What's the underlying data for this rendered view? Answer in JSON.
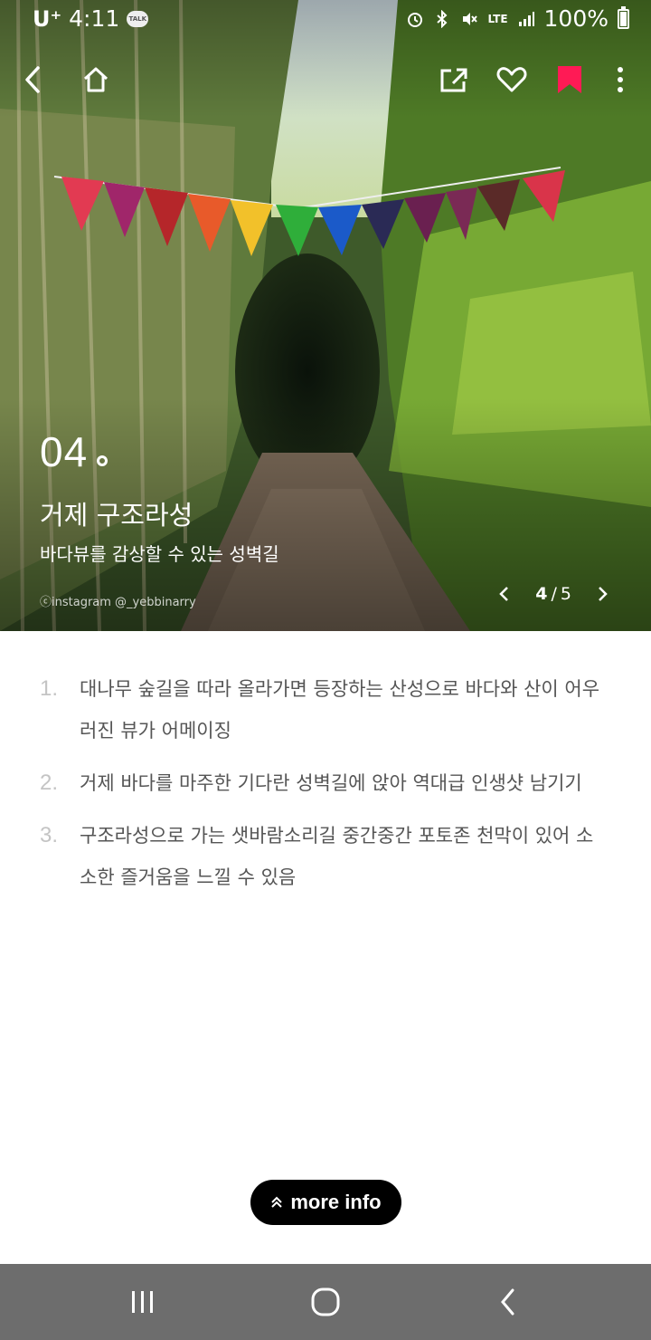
{
  "statusbar": {
    "carrier": "U⁺",
    "time": "4:11",
    "talk_badge": "TALK",
    "network": "LTE",
    "battery": "100%",
    "icons": [
      "alarm-icon",
      "bluetooth-icon",
      "mute-icon",
      "signal-icon",
      "battery-icon"
    ]
  },
  "toolbar": {
    "icons": [
      "back-icon",
      "home-icon",
      "share-icon",
      "like-icon",
      "bookmark-icon",
      "more-icon"
    ],
    "bookmark_color": "#ff1a55"
  },
  "hero": {
    "number": "04",
    "title": "거제 구조라성",
    "subtitle": "바다뷰를 감상할 수 있는 성벽길",
    "credit": "ⓒinstagram @_yebbinarry",
    "pager": {
      "current": "4",
      "separator": "/",
      "total": "5"
    }
  },
  "list": [
    {
      "num": "1.",
      "text": "대나무 숲길을 따라 올라가면 등장하는 산성으로 바다와 산이 어우러진 뷰가 어메이징"
    },
    {
      "num": "2.",
      "text": "거제 바다를 마주한 기다란 성벽길에 앉아 역대급 인생샷 남기기"
    },
    {
      "num": "3.",
      "text": "구조라성으로 가는 샛바람소리길 중간중간 포토존 천막이 있어 소소한 즐거움을 느낄 수 있음"
    }
  ],
  "more_button": {
    "label": "more info",
    "icon": "double-chevron-up-icon"
  },
  "navbar": {
    "icons": [
      "recents-icon",
      "home-circle-icon",
      "nav-back-icon"
    ]
  }
}
